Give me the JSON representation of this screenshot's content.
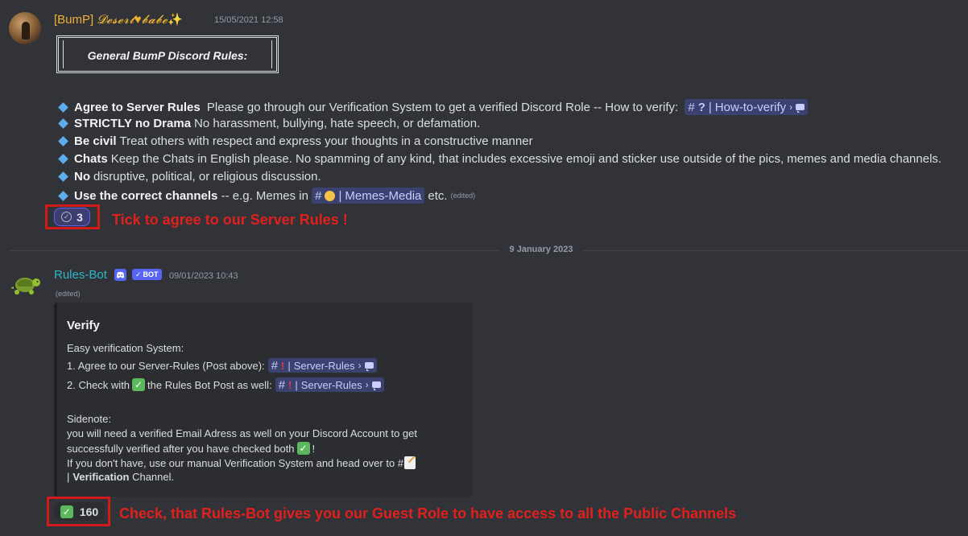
{
  "message1": {
    "username_prefix": "[BumP]",
    "username_fancy": "𝓓𝓮𝓼𝓮𝓻𝓽",
    "username_heart": "♥",
    "username_fancy2": "𝓫𝓪𝓫𝓮",
    "username_sparkle": "✨",
    "timestamp": "15/05/2021 12:58",
    "rules_title": "General BumP Discord Rules:",
    "rules": [
      {
        "bold": "Agree to Server Rules",
        "text": " Please go through our Verification System to get a verified Discord Role -- How to verify: "
      },
      {
        "bold": "STRICTLY no Drama",
        "text": "No harassment, bullying, hate speech, or defamation."
      },
      {
        "bold": "Be civil",
        "text": "Treat others with respect and express your thoughts in a constructive manner"
      },
      {
        "bold": "Chats",
        "text": "Keep the Chats in English please. No spamming of any kind, that includes excessive emoji and sticker use outside of the pics, memes and media channels."
      },
      {
        "bold": "No",
        "text": "disruptive, political, or religious discussion."
      },
      {
        "bold": "Use the correct channels",
        "text": " -- e.g. Memes in ",
        "after": "etc."
      }
    ],
    "how_to_verify_channel": "How-to-verify",
    "memes_channel": "Memes-Media",
    "edited_label": "(edited)",
    "reaction_count": "3",
    "annotation": "Tick to agree to our Server Rules !"
  },
  "divider": {
    "date": "9 January 2023"
  },
  "message2": {
    "username": "Rules-Bot",
    "bot_tag": "BOT",
    "timestamp": "09/01/2023 10:43",
    "edited_label": "(edited)",
    "embed": {
      "title": "Verify",
      "line1": "Easy verification System:",
      "line2_prefix": "1. Agree to our Server-Rules (Post above):",
      "line3_prefix": "2. Check with",
      "line3_mid": "the Rules Bot Post as well:",
      "channel": "Server-Rules",
      "sidenote_label": "Sidenote:",
      "sidenote1": "you will need a verified Email Adress as well on your Discord Account to get",
      "sidenote2": "successfully verified after you have checked both",
      "sidenote2_end": "!",
      "sidenote3": "If you don't have, use our manual Verification System and head over to #",
      "sidenote4_bold": "Verification",
      "sidenote4": " Channel."
    },
    "reaction_count": "160",
    "annotation": "Check, that Rules-Bot gives you our Guest Role to have access to all the Public Channels"
  },
  "colors": {
    "background": "#313338",
    "annotation_red": "#e0201c",
    "mention_bg": "#3c4270",
    "bot_username": "#2db8c4",
    "user1_username": "#f0b232",
    "blurple": "#5865f2"
  }
}
